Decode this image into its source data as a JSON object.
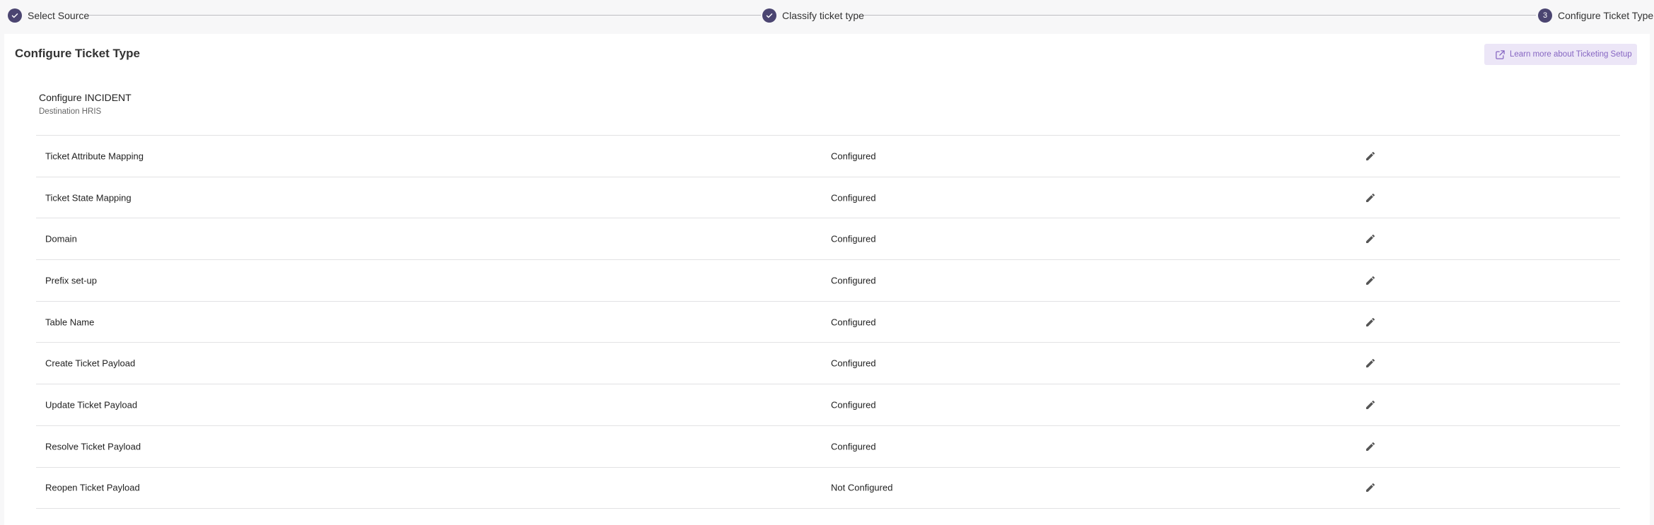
{
  "stepper": {
    "steps": [
      {
        "label": "Select Source",
        "state": "done"
      },
      {
        "label": "Classify ticket type",
        "state": "done"
      },
      {
        "label": "Configure Ticket Type",
        "state": "active",
        "number": "3"
      }
    ]
  },
  "page": {
    "title": "Configure Ticket Type",
    "learn_more": "Learn more about Ticketing Setup"
  },
  "config": {
    "title": "Configure INCIDENT",
    "subtitle": "Destination HRIS"
  },
  "rows": [
    {
      "name": "Ticket Attribute Mapping",
      "status": "Configured"
    },
    {
      "name": "Ticket State Mapping",
      "status": "Configured"
    },
    {
      "name": "Domain",
      "status": "Configured"
    },
    {
      "name": "Prefix set-up",
      "status": "Configured"
    },
    {
      "name": "Table Name",
      "status": "Configured"
    },
    {
      "name": "Create Ticket Payload",
      "status": "Configured"
    },
    {
      "name": "Update Ticket Payload",
      "status": "Configured"
    },
    {
      "name": "Resolve Ticket Payload",
      "status": "Configured"
    },
    {
      "name": "Reopen Ticket Payload",
      "status": "Not Configured"
    }
  ],
  "colors": {
    "accent": "#4b4571",
    "link": "#8666c2",
    "link_bg": "#ece6f7"
  }
}
